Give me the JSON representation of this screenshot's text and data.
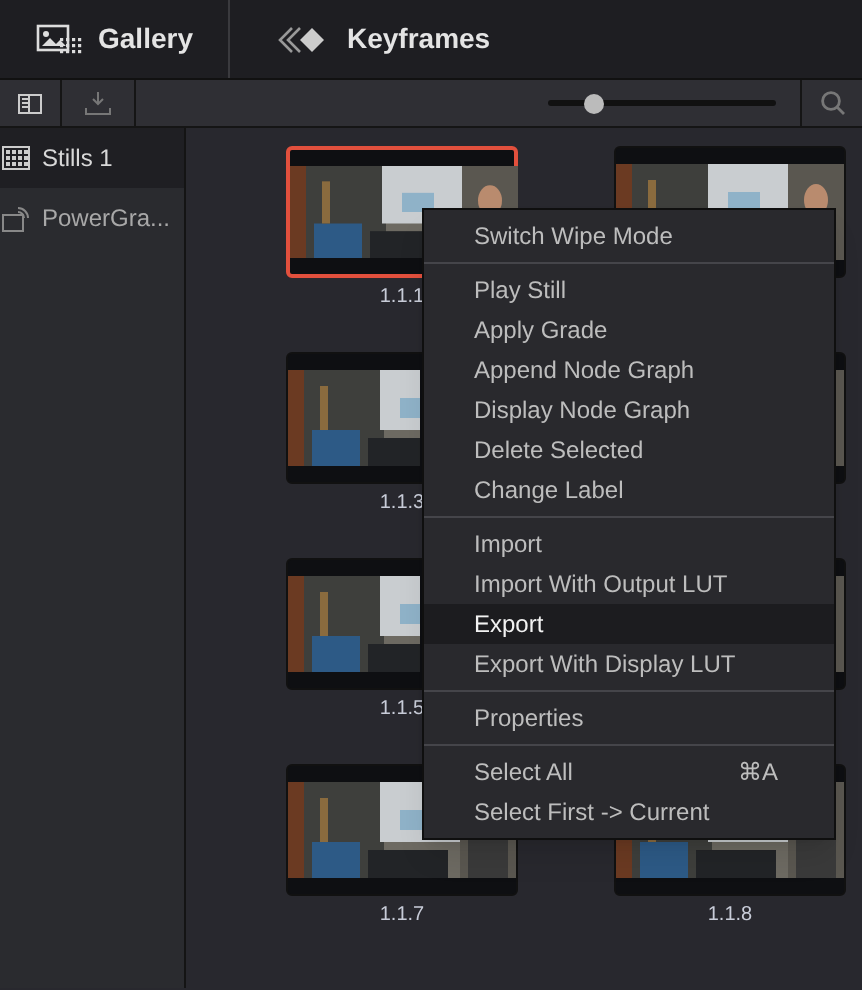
{
  "header": {
    "tabs": [
      {
        "label": "Gallery",
        "kind": "gallery"
      },
      {
        "label": "Keyframes",
        "kind": "keyframes"
      }
    ]
  },
  "toolbar": {
    "zoom_slider": {
      "level": 0.2
    }
  },
  "sidebar": {
    "items": [
      {
        "label": "Stills 1",
        "kind": "stills",
        "selected": true
      },
      {
        "label": "PowerGra...",
        "kind": "power",
        "selected": false
      }
    ]
  },
  "stills": [
    {
      "label": "1.1.1",
      "selected": true
    },
    {
      "selected": false
    },
    {
      "label": "1.1.3",
      "selected": false
    },
    {
      "selected": false
    },
    {
      "label": "1.1.5",
      "selected": false
    },
    {
      "selected": false
    },
    {
      "label": "1.1.7",
      "selected": false
    },
    {
      "label": "1.1.8",
      "selected": false
    }
  ],
  "context_menu": {
    "groups": [
      [
        {
          "label": "Switch Wipe Mode",
          "highlighted": false
        }
      ],
      [
        {
          "label": "Play Still",
          "highlighted": false
        },
        {
          "label": "Apply Grade",
          "highlighted": false
        },
        {
          "label": "Append Node Graph",
          "highlighted": false
        },
        {
          "label": "Display Node Graph",
          "highlighted": false
        },
        {
          "label": "Delete Selected",
          "highlighted": false
        },
        {
          "label": "Change Label",
          "highlighted": false
        }
      ],
      [
        {
          "label": "Import",
          "highlighted": false
        },
        {
          "label": "Import With Output LUT",
          "highlighted": false
        },
        {
          "label": "Export",
          "highlighted": true
        },
        {
          "label": "Export With Display LUT",
          "highlighted": false
        }
      ],
      [
        {
          "label": "Properties",
          "highlighted": false
        }
      ],
      [
        {
          "label": "Select All",
          "shortcut": "⌘A",
          "highlighted": false
        },
        {
          "label": "Select First -> Current",
          "highlighted": false
        }
      ]
    ]
  }
}
